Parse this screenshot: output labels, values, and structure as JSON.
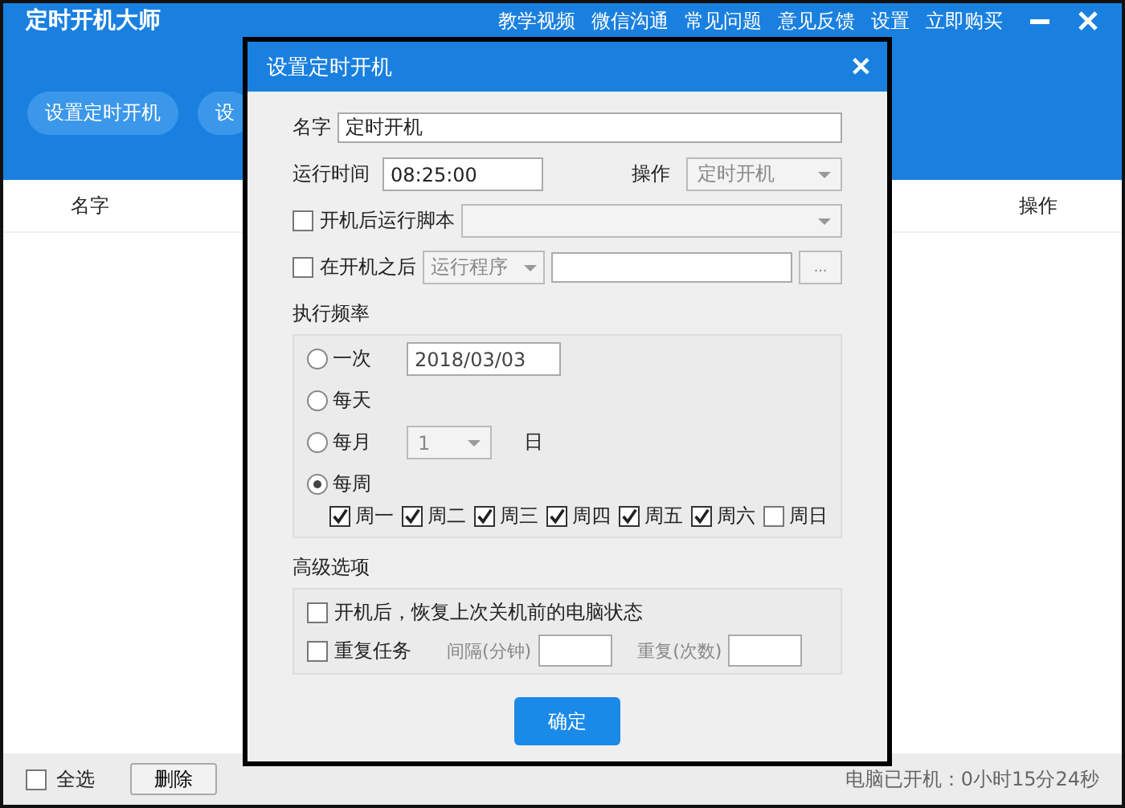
{
  "app": {
    "title": "定时开机大师",
    "menu": [
      "教学视频",
      "微信沟通",
      "常见问题",
      "意见反馈",
      "设置",
      "立即购买"
    ]
  },
  "toolbar": [
    "设置定时开机",
    "设"
  ],
  "table": {
    "columns": [
      "名字",
      "操作"
    ]
  },
  "footer": {
    "select_all": {
      "label": "全选",
      "checked": false
    },
    "delete_button": "删除",
    "status": "电脑已开机：0小时15分24秒"
  },
  "dialog": {
    "title": "设置定时开机",
    "close": "✕",
    "name": {
      "label": "名字",
      "value": "定时开机"
    },
    "run_time": {
      "label": "运行时间",
      "value": "08:25:00"
    },
    "action": {
      "label": "操作",
      "value": "定时开机",
      "disabled": true
    },
    "run_script": {
      "label": "开机后运行脚本",
      "checked": false
    },
    "after_boot": {
      "label": "在开机之后",
      "checked": false,
      "program_type": "运行程序",
      "browse": "..."
    },
    "frequency": {
      "label": "执行频率",
      "options": [
        {
          "kind": "date",
          "label": "一次",
          "selected": false,
          "value": "2018/03/03"
        },
        {
          "kind": "plain",
          "label": "每天",
          "selected": false
        },
        {
          "kind": "month",
          "label": "每月",
          "selected": false,
          "value": "1",
          "suffix": "日"
        },
        {
          "kind": "week",
          "label": "每周",
          "selected": true
        }
      ],
      "days": [
        {
          "label": "周一",
          "checked": true
        },
        {
          "label": "周二",
          "checked": true
        },
        {
          "label": "周三",
          "checked": true
        },
        {
          "label": "周四",
          "checked": true
        },
        {
          "label": "周五",
          "checked": true
        },
        {
          "label": "周六",
          "checked": true
        },
        {
          "label": "周日",
          "checked": false
        }
      ]
    },
    "advanced": {
      "label": "高级选项",
      "restore": {
        "label": "开机后，恢复上次关机前的电脑状态",
        "checked": false
      },
      "repeat": {
        "label": "重复任务",
        "checked": false
      },
      "interval_label": "间隔(分钟)",
      "count_label": "重复(次数)"
    },
    "ok": "确定"
  }
}
